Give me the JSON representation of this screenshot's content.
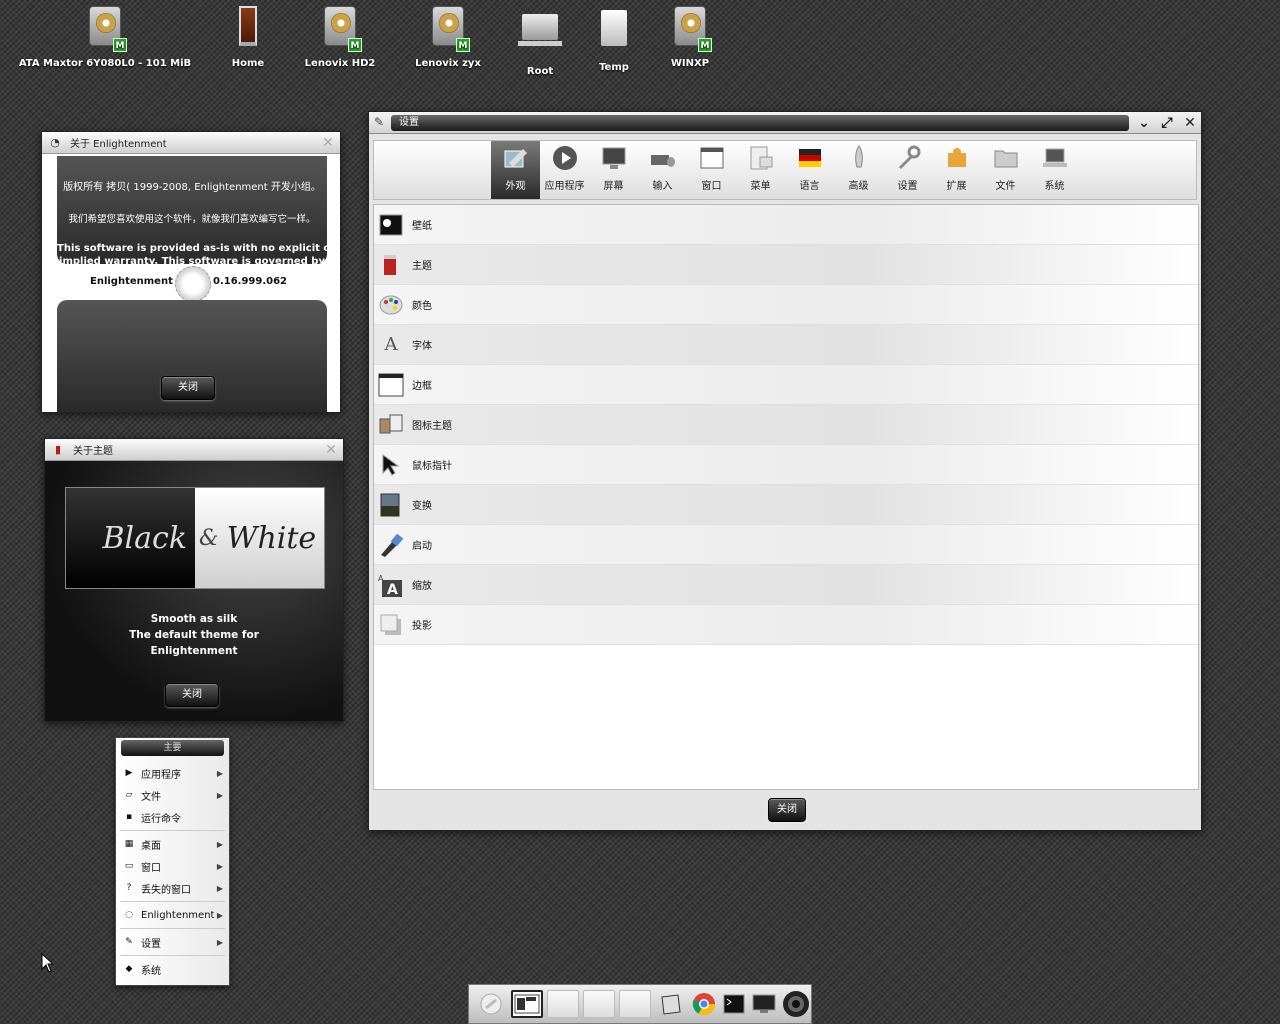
{
  "desktop_icons": [
    {
      "label": "ATA Maxtor 6Y080L0 - 101 MiB",
      "icon": "hard-drive-icon"
    },
    {
      "label": "Home",
      "icon": "home-door-icon"
    },
    {
      "label": "Lenovix HD2",
      "icon": "hard-drive-icon"
    },
    {
      "label": "Lenovix zyx",
      "icon": "hard-drive-icon"
    },
    {
      "label": "Root",
      "icon": "laptop-icon"
    },
    {
      "label": "Temp",
      "icon": "box-icon"
    },
    {
      "label": "WINXP",
      "icon": "hard-drive-icon"
    }
  ],
  "mount_badge": "M",
  "about_e": {
    "title": "关于 Enlightenment",
    "line1": "版权所有 拷贝( 1999-2008, Enlightenment 开发小组。",
    "line2": "我们希望您喜欢使用这个软件，就像我们喜欢编写它一样。",
    "line3": "This software is provided as-is with no explicit or",
    "line4": "implied warranty. This software is governed by",
    "name": "Enlightenment",
    "version": "0.16.999.062",
    "close": "关闭"
  },
  "about_theme": {
    "title": "关于主题",
    "logo_left": "Black",
    "logo_amp": "&",
    "logo_right": "White",
    "desc1": "Smooth as silk",
    "desc2": "The default theme for",
    "desc3": "Enlightenment",
    "close": "关闭"
  },
  "settings": {
    "title": "设置",
    "tabs": [
      "外观",
      "应用程序",
      "屏幕",
      "输入",
      "窗口",
      "菜单",
      "语言",
      "高级",
      "设置",
      "扩展",
      "文件",
      "系统"
    ],
    "items": [
      "壁纸",
      "主题",
      "颜色",
      "字体",
      "边框",
      "图标主题",
      "鼠标指针",
      "变换",
      "启动",
      "缩放",
      "投影"
    ],
    "close": "关闭"
  },
  "menu": {
    "header": "主要",
    "items": [
      "应用程序",
      "文件",
      "运行命令",
      "桌面",
      "窗口",
      "丢失的窗口",
      "Enlightenment",
      "设置",
      "系统"
    ]
  },
  "colors": {
    "accent_dark": "#1a1a1a",
    "badge_green": "#2e9e2e"
  }
}
